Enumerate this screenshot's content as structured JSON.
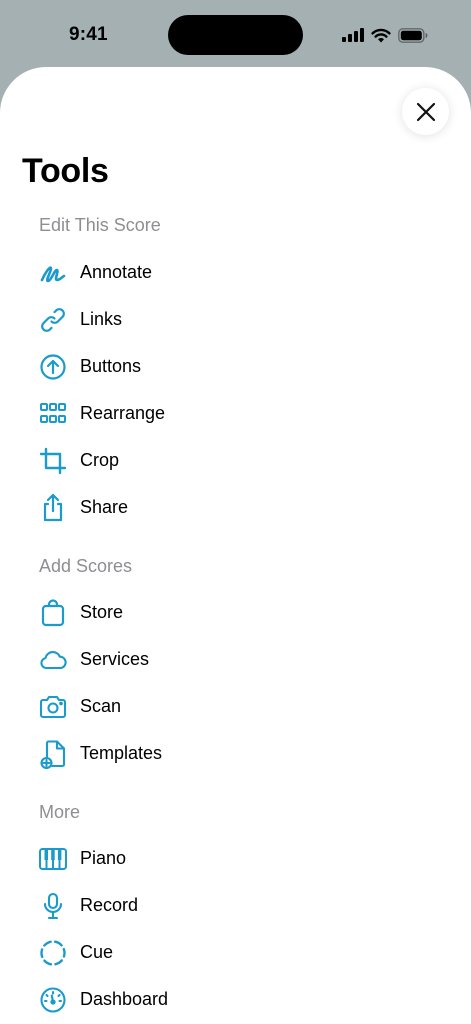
{
  "status_bar": {
    "time": "9:41"
  },
  "sheet": {
    "title": "Tools",
    "accent_color": "#1a9bcb",
    "sections": [
      {
        "header": "Edit This Score",
        "items": [
          {
            "label": "Annotate",
            "icon": "scribble-icon"
          },
          {
            "label": "Links",
            "icon": "link-icon"
          },
          {
            "label": "Buttons",
            "icon": "arrow-up-circle-icon"
          },
          {
            "label": "Rearrange",
            "icon": "grid-icon"
          },
          {
            "label": "Crop",
            "icon": "crop-icon"
          },
          {
            "label": "Share",
            "icon": "share-icon"
          }
        ]
      },
      {
        "header": "Add Scores",
        "items": [
          {
            "label": "Store",
            "icon": "bag-icon"
          },
          {
            "label": "Services",
            "icon": "cloud-icon"
          },
          {
            "label": "Scan",
            "icon": "camera-icon"
          },
          {
            "label": "Templates",
            "icon": "document-add-icon"
          }
        ]
      },
      {
        "header": "More",
        "items": [
          {
            "label": "Piano",
            "icon": "piano-icon"
          },
          {
            "label": "Record",
            "icon": "microphone-icon"
          },
          {
            "label": "Cue",
            "icon": "dashed-circle-icon"
          },
          {
            "label": "Dashboard",
            "icon": "gauge-icon"
          }
        ]
      }
    ]
  }
}
